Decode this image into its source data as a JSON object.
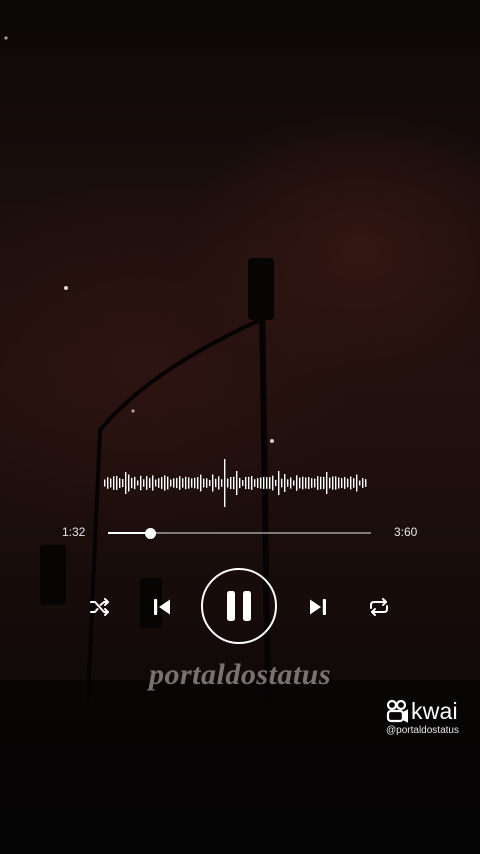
{
  "player": {
    "elapsed": "1:32",
    "total": "3:60",
    "progress_fraction": 0.16,
    "controls": {
      "shuffle": "shuffle-icon",
      "previous": "skip-previous-icon",
      "play_pause": "pause-icon",
      "next": "skip-next-icon",
      "repeat": "repeat-icon"
    }
  },
  "overlay": {
    "watermark": "portaldostatus",
    "brand": "kwai",
    "handle": "@portaldostatus"
  },
  "colors": {
    "foreground": "#ffffff",
    "background": "#0c0706",
    "tint": "#22110e"
  }
}
